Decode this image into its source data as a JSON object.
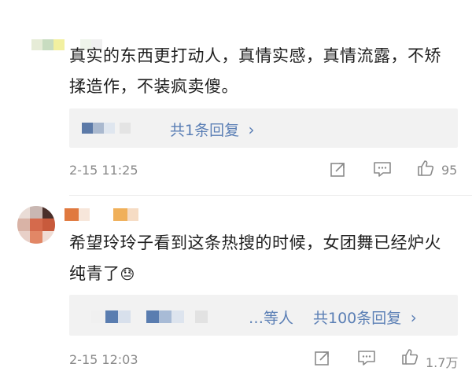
{
  "comments": [
    {
      "text": "真实的东西更打动人，真情实感，真情流露，不矫揉造作，不装疯卖傻。",
      "reply_summary": "共1条回复",
      "time": "2-15 11:25",
      "likes": "95"
    },
    {
      "text": "希望玲玲子看到这条热搜的时候，女团舞已经炉火纯青了",
      "emoji": "😓",
      "reply_prefix": "…等人",
      "reply_summary": "共100条回复",
      "time": "2-15 12:03",
      "likes": "1.7万"
    }
  ],
  "icons": {
    "repost": "repost-icon",
    "comment": "comment-icon",
    "like": "thumbs-up-icon",
    "chevron": "chevron-right-icon"
  },
  "colors": {
    "link": "#5b7fb5",
    "text": "#1f1f1f",
    "meta": "#8a8a8a",
    "reply_bg": "#f2f2f2"
  }
}
